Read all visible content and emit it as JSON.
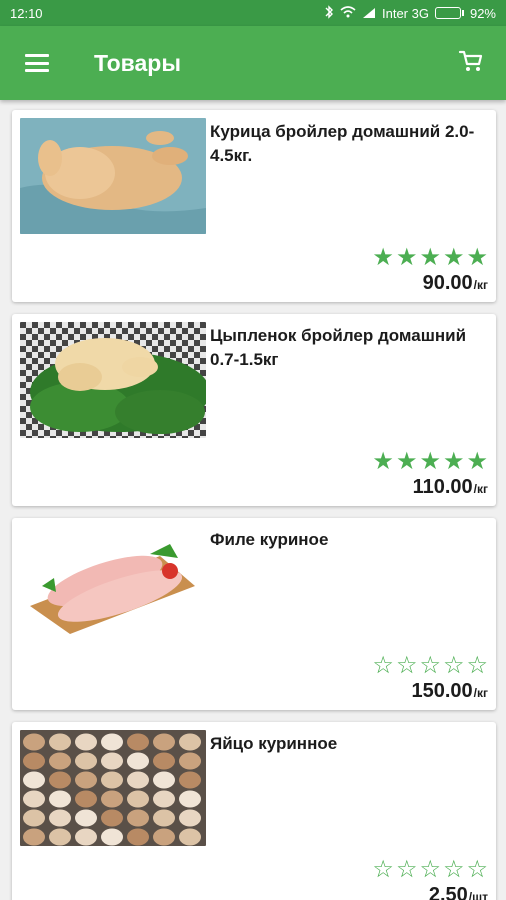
{
  "status_bar": {
    "time": "12:10",
    "carrier": "Inter 3G",
    "battery": "92%",
    "battery_level": 0.92
  },
  "app_bar": {
    "title": "Товары",
    "menu_icon": "hamburger-menu-icon",
    "cart_icon": "cart-icon"
  },
  "products": [
    {
      "name": "Курица бройлер домашний 2.0-4.5кг.",
      "price": "90.00",
      "unit": "/кг",
      "rating": 5,
      "image": "whole-chicken"
    },
    {
      "name": "Цыпленок бройлер домашний 0.7-1.5кг",
      "price": "110.00",
      "unit": "/кг",
      "rating": 5,
      "image": "chicken-on-parsley"
    },
    {
      "name": "Филе куриное",
      "price": "150.00",
      "unit": "/кг",
      "rating": 0,
      "image": "chicken-fillet"
    },
    {
      "name": "Яйцо куринное",
      "price": "2.50",
      "unit": "/шт",
      "rating": 0,
      "image": "egg-tray"
    }
  ],
  "colors": {
    "status_bar": "#3a9a46",
    "app_bar": "#4cae52",
    "star": "#4cae52"
  }
}
